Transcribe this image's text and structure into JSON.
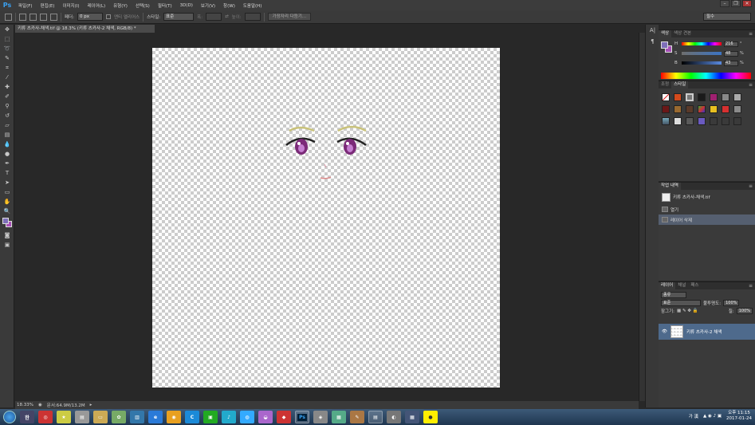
{
  "app": {
    "logo": "Ps"
  },
  "menu": [
    "파일(F)",
    "편집(E)",
    "이미지(I)",
    "레이어(L)",
    "유형(Y)",
    "선택(S)",
    "필터(T)",
    "3D(D)",
    "보기(V)",
    "창(W)",
    "도움말(H)"
  ],
  "options": {
    "feather_label": "페더:",
    "feather_value": "0 px",
    "antialias_label": "앤티 앨리어스",
    "style_label": "스타일:",
    "style_value": "표준",
    "width_label": "폭:",
    "height_label": "높이:",
    "refine_button": "가장자리 다듬기...",
    "workspace": "필수"
  },
  "document": {
    "tab_title": "키류 츠카사-채색.tif @ 18.3% (키류 츠카사-2 채색, RGB/8) *",
    "zoom": "18.33%",
    "doc_size": "문서:64.9M/13.2M"
  },
  "color_panel": {
    "tabs": [
      "색상",
      "색상 견본"
    ],
    "h": {
      "label": "H",
      "value": "216",
      "unit": "°"
    },
    "s": {
      "label": "S",
      "value": "48",
      "unit": "%"
    },
    "b": {
      "label": "B",
      "value": "43",
      "unit": "%"
    },
    "fg": "#7e6fb8",
    "bg": "#a84fb8"
  },
  "adjust_panel": {
    "tabs": [
      "조정",
      "스타일"
    ]
  },
  "history_panel": {
    "tabs": [
      "작업 내역"
    ],
    "items": [
      {
        "label": "키류 츠카사-채색.tif",
        "selected": false
      },
      {
        "label": "열기",
        "selected": false
      },
      {
        "label": "레이어 삭제",
        "selected": true
      }
    ]
  },
  "layers_panel": {
    "tabs": [
      "레이어",
      "채널",
      "패스"
    ],
    "kind_label": "종류",
    "blend_mode": "표준",
    "opacity_label": "불투명도:",
    "opacity_value": "100%",
    "lock_label": "잠그기:",
    "fill_label": "칠:",
    "fill_value": "100%",
    "layer_name": "키류 츠카사-2 채색"
  },
  "taskbar": {
    "ime": "가 漢",
    "time": "오후 11:15",
    "date": "2017-01-24"
  }
}
